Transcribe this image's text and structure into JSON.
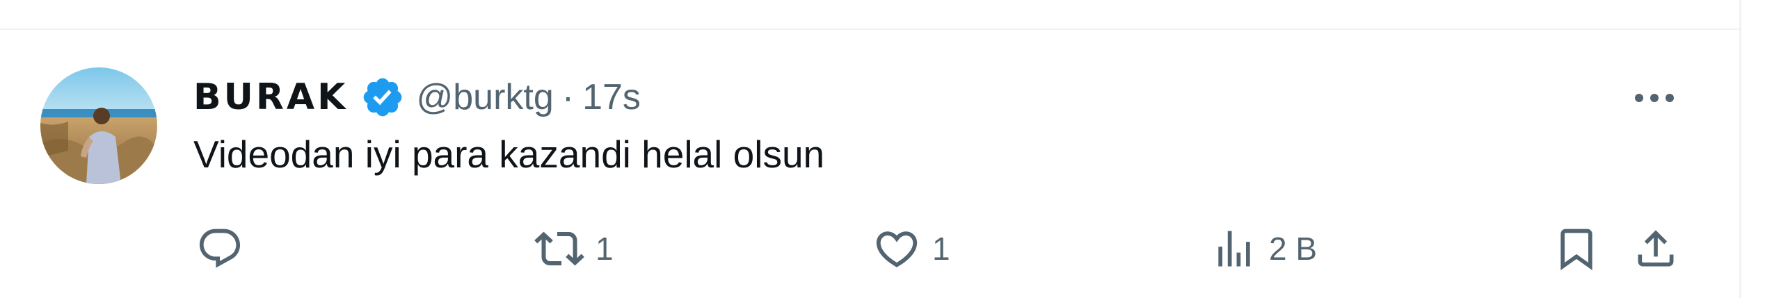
{
  "tweet": {
    "display_name": "BURAK",
    "handle": "@burktg",
    "separator": "·",
    "time": "17s",
    "text": "Videodan iyi para kazandi helal olsun",
    "verified_color": "#1d9bf0"
  },
  "actions": {
    "reply": {
      "icon": "reply-icon"
    },
    "retweet": {
      "icon": "retweet-icon",
      "count": "1"
    },
    "like": {
      "icon": "heart-icon",
      "count": "1"
    },
    "views": {
      "icon": "views-chart-icon",
      "count": "2 B"
    },
    "bookmark": {
      "icon": "bookmark-icon"
    },
    "share": {
      "icon": "share-icon"
    }
  },
  "colors": {
    "text": "#0f1419",
    "secondary": "#536471",
    "divider": "#eff3f4"
  }
}
